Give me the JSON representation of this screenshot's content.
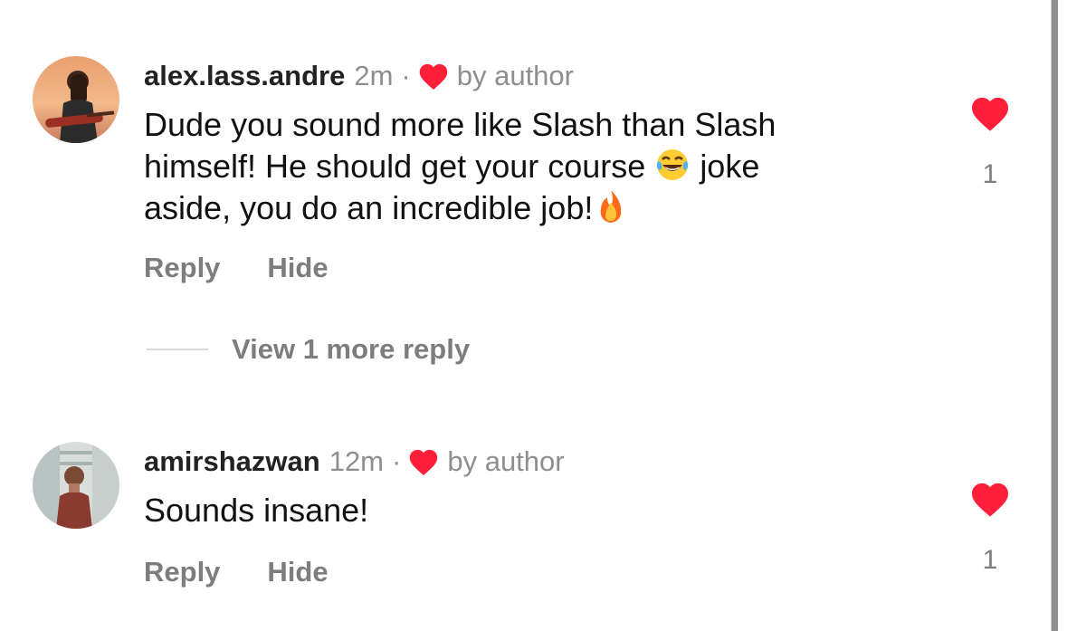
{
  "colors": {
    "heart_red": "#ff1f3a",
    "secondary_text": "#8e8e8e",
    "action_text": "#7d7d7d",
    "primary_text": "#111111"
  },
  "comments": [
    {
      "username": "alex.lass.andre",
      "time": "2m",
      "separator": "·",
      "author_like_label": "by author",
      "author_like_icon": "heart-icon",
      "text_line_1": "Dude you sound more like Slash than Slash",
      "text_line_2_before": "himself! He should get your course",
      "emoji_1": "face-with-tears-of-joy",
      "text_line_2_after": "joke",
      "text_line_3": "aside, you do an incredible job!",
      "emoji_2": "fire",
      "reply_label": "Reply",
      "hide_label": "Hide",
      "like_icon": "heart-icon",
      "like_count": "1"
    },
    {
      "username": "amirshazwan",
      "time": "12m",
      "separator": "·",
      "author_like_label": "by author",
      "author_like_icon": "heart-icon",
      "text": "Sounds insane!",
      "reply_label": "Reply",
      "hide_label": "Hide",
      "like_icon": "heart-icon",
      "like_count": "1"
    }
  ],
  "view_more_replies": "View 1 more reply"
}
